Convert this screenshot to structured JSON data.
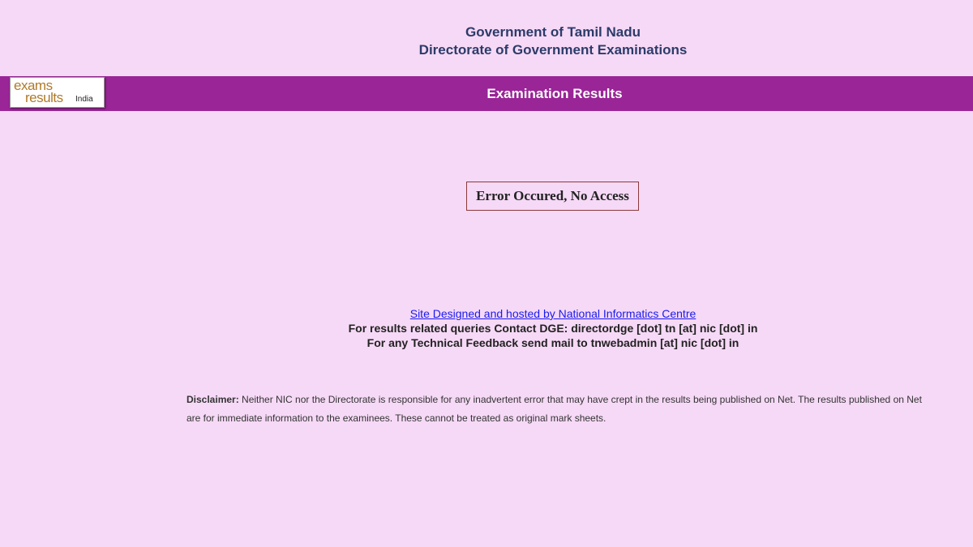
{
  "header": {
    "line1": "Government of Tamil Nadu",
    "line2": "Directorate of Government Examinations"
  },
  "titlebar": {
    "logo": {
      "word1": "exams",
      "word2": "results",
      "word3": "India"
    },
    "title": "Examination Results"
  },
  "error": {
    "message": "Error Occured, No Access"
  },
  "footer": {
    "link_text": "Site Designed and hosted by National Informatics Centre",
    "contact_line": "For results related queries Contact DGE:  directordge [dot] tn [at] nic [dot] in",
    "feedback_line": "For any Technical Feedback send mail to tnwebadmin [at] nic [dot] in"
  },
  "disclaimer": {
    "label": "Disclaimer:",
    "text": " Neither NIC nor the Directorate is responsible for any inadvertent error that may have crept in the results being published on Net. The results published on Net are for immediate information to the examinees. These cannot be treated as original mark sheets."
  },
  "colors": {
    "background": "#f6d9f6",
    "titlebar": "#9a2597",
    "header_text": "#2c3b69",
    "link": "#1a1aee",
    "error_border": "#8b3a3a"
  }
}
